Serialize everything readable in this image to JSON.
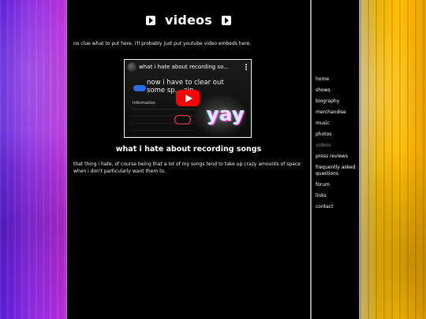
{
  "page": {
    "title": "videos",
    "intro": "no clue what to put here. i'll probably just put youtube video embeds here."
  },
  "video_embed": {
    "title_overlay": "what i hate about recording so...",
    "on_screen_text": "now i have to clear out some sp... ain",
    "info_label": "Information",
    "sticker_text": "yay"
  },
  "video_section": {
    "heading": "what i hate about recording songs",
    "description": "that thing i hate, of course being that a lot of my songs tend to take up crazy amounts of space when i don't particularly want them to."
  },
  "sidebar": {
    "items": [
      {
        "label": "home"
      },
      {
        "label": "shows"
      },
      {
        "label": "biography"
      },
      {
        "label": "merchandise"
      },
      {
        "label": "music"
      },
      {
        "label": "photos"
      },
      {
        "label": "videos",
        "active": true
      },
      {
        "label": "press reviews"
      },
      {
        "label": "frequently asked questions"
      },
      {
        "label": "forum"
      },
      {
        "label": "links"
      },
      {
        "label": "contact"
      }
    ]
  },
  "colors": {
    "accent_red": "#ff0000",
    "link_active": "#8c8c8c"
  },
  "icons": {
    "title_left": "play-icon",
    "title_right": "play-icon",
    "embed_play": "youtube-play-icon",
    "embed_menu": "kebab-menu-icon"
  }
}
